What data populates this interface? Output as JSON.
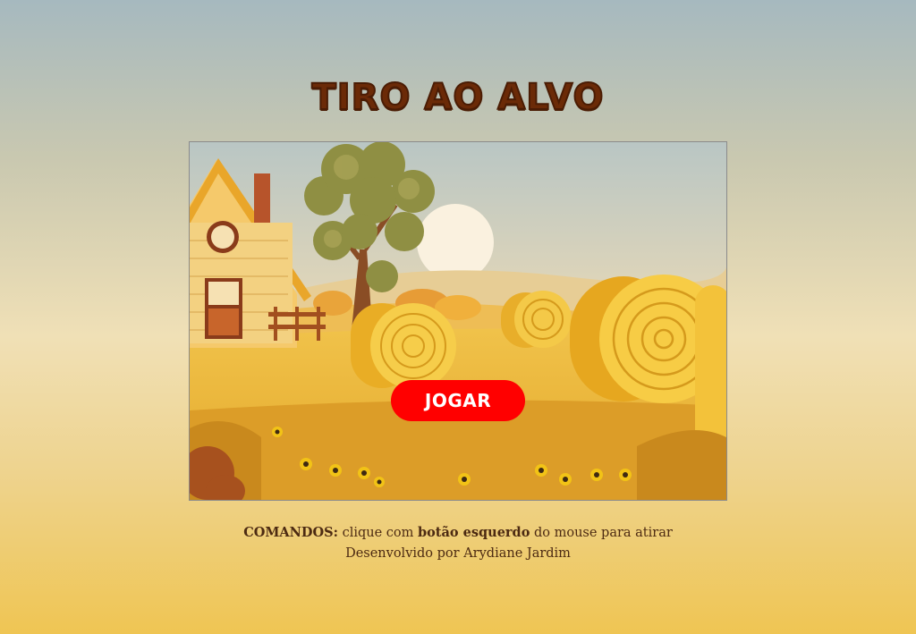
{
  "title": "TIRO AO ALVO",
  "game": {
    "play_label": "JOGAR"
  },
  "footer": {
    "commands_label": "COMANDOS:",
    "commands_text_1": " clique com ",
    "commands_bold": "botão esquerdo",
    "commands_text_2": " do mouse para atirar",
    "credits": "Desenvolvido por Arydiane Jardim"
  },
  "colors": {
    "title": "#6b2a07",
    "play_button": "#ff0000"
  }
}
